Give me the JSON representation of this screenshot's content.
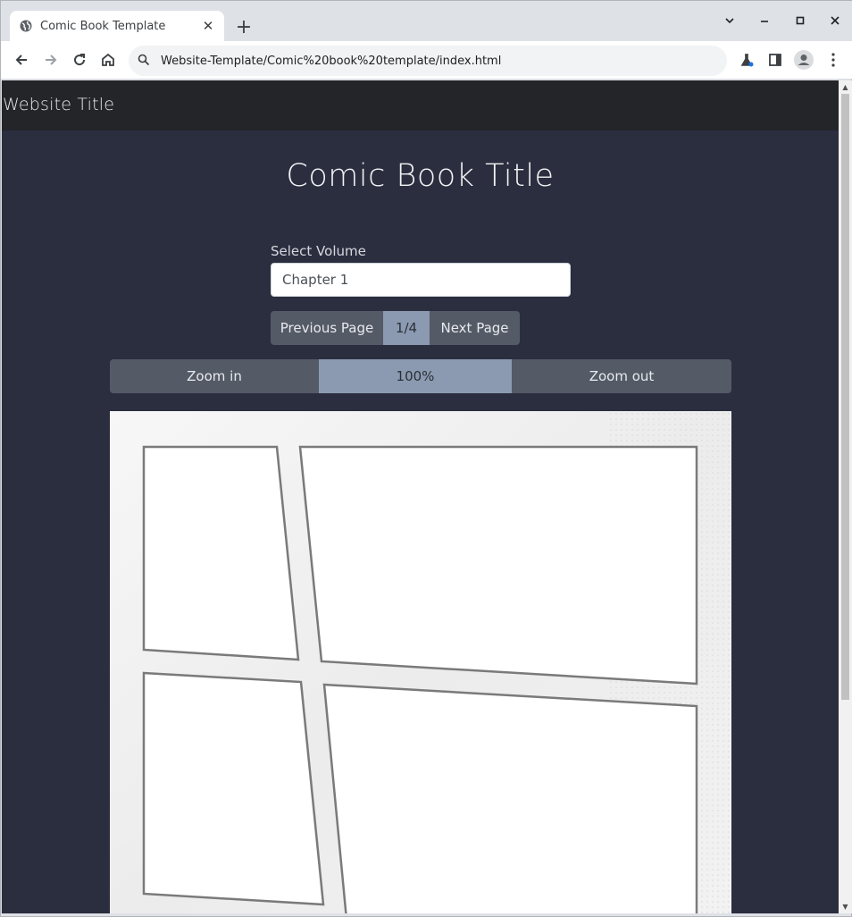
{
  "browser": {
    "tab_title": "Comic Book Template",
    "url": "Website-Template/Comic%20book%20template/index.html"
  },
  "site": {
    "title": "Website Title"
  },
  "comic": {
    "title": "Comic Book Title",
    "volume_label": "Select Volume",
    "volume_selected": "Chapter 1",
    "prev_label": "Previous Page",
    "page_indicator": "1/4",
    "next_label": "Next Page",
    "zoom_in_label": "Zoom in",
    "zoom_value": "100%",
    "zoom_out_label": "Zoom out"
  },
  "colors": {
    "page_bg": "#2b2e3f",
    "header_bg": "#232529",
    "button_bg": "#545a66",
    "button_active_bg": "#8b9ab0"
  },
  "icons": [
    "globe-icon",
    "close-icon",
    "plus-icon",
    "chevron-down-icon",
    "minimize-icon",
    "maximize-icon",
    "back-icon",
    "forward-icon",
    "reload-icon",
    "home-icon",
    "search-icon",
    "flask-icon",
    "side-panel-icon",
    "profile-icon",
    "menu-icon"
  ]
}
